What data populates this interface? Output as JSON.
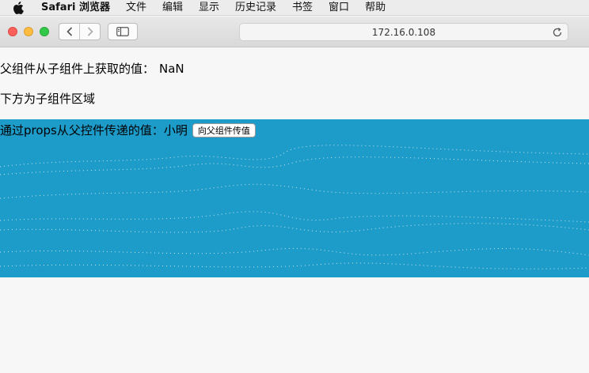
{
  "menubar": {
    "app_name": "Safari 浏览器",
    "items": [
      "文件",
      "编辑",
      "显示",
      "历史记录",
      "书签",
      "窗口",
      "帮助"
    ]
  },
  "browser": {
    "url": "172.16.0.108"
  },
  "page": {
    "parent_label": "父组件从子组件上获取的值：",
    "parent_value": "NaN",
    "child_heading": "下方为子组件区域",
    "child_label": "通过props从父控件传递的值：",
    "child_value": "小明",
    "send_button": "向父组件传值"
  },
  "colors": {
    "child_background": "#1d9bc9",
    "page_background": "#f7f7f7"
  }
}
